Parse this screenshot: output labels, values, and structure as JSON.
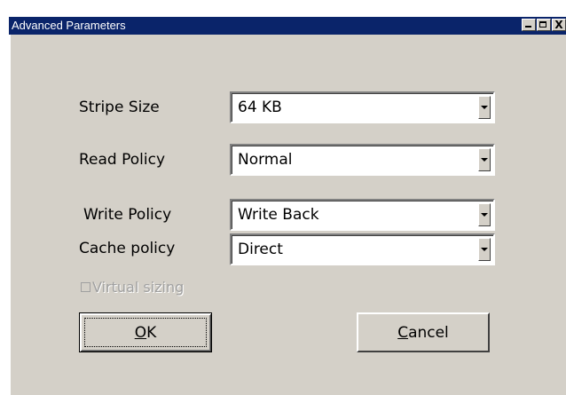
{
  "window": {
    "title": "Advanced Parameters",
    "controls": {
      "minimize_icon": "minimize-icon",
      "maximize_icon": "maximize-icon",
      "close_glyph": "X"
    }
  },
  "fields": {
    "stripe_size": {
      "label": "Stripe Size",
      "value": "64 KB"
    },
    "read_policy": {
      "label": "Read Policy",
      "value": "Normal"
    },
    "write_policy": {
      "label": "Write Policy",
      "value": "Write Back"
    },
    "cache_policy": {
      "label": "Cache policy",
      "value": "Direct"
    }
  },
  "virtual_sizing": {
    "label": "Virtual sizing",
    "checked": false,
    "enabled": false
  },
  "buttons": {
    "ok": {
      "mnemonic": "O",
      "rest": "K"
    },
    "cancel": {
      "mnemonic": "C",
      "rest": "ancel"
    }
  }
}
